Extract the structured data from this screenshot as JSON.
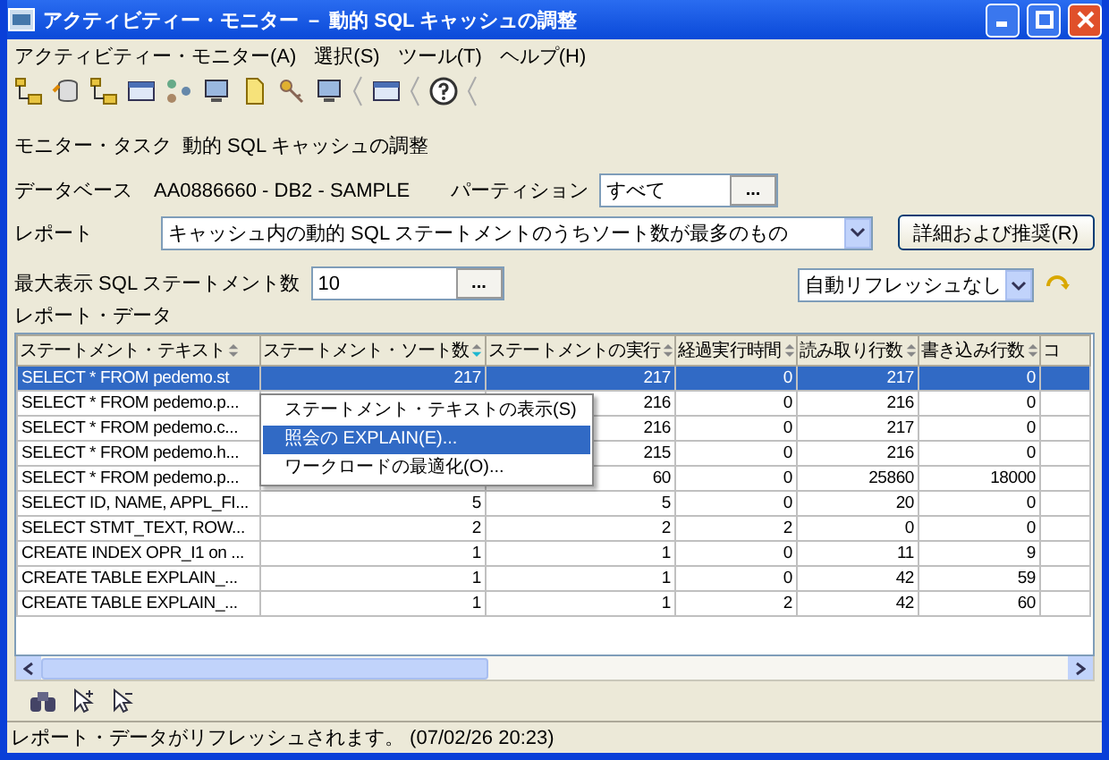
{
  "window": {
    "title": "アクティビティー・モニター － 動的 SQL キャッシュの調整"
  },
  "menu": [
    "アクティビティー・モニター(A)",
    "選択(S)",
    "ツール(T)",
    "ヘルプ(H)"
  ],
  "toolbar": [
    {
      "kind": "tree"
    },
    {
      "kind": "db"
    },
    {
      "kind": "tree"
    },
    {
      "kind": "window"
    },
    {
      "kind": "nodes"
    },
    {
      "kind": "monitor"
    },
    {
      "kind": "doc"
    },
    {
      "kind": "key"
    },
    {
      "kind": "monitor"
    },
    {
      "kind": "sep"
    },
    {
      "kind": "window"
    },
    {
      "kind": "sep"
    },
    {
      "kind": "help"
    },
    {
      "kind": "sep"
    }
  ],
  "task": {
    "label": "モニター・タスク",
    "value": "動的 SQL キャッシュの調整"
  },
  "database": {
    "label": "データベース",
    "value": "AA0886660 - DB2 - SAMPLE"
  },
  "partition": {
    "label": "パーティション",
    "value": "すべて",
    "button": "..."
  },
  "report": {
    "label": "レポート",
    "value": "キャッシュ内の動的 SQL ステートメントのうちソート数が最多のもの",
    "button": "詳細および推奨(R)"
  },
  "max_rows": {
    "label": "最大表示 SQL ステートメント数",
    "value": "10",
    "button": "..."
  },
  "auto_refresh": {
    "value": "自動リフレッシュなし"
  },
  "report_data": {
    "label": "レポート・データ"
  },
  "table": {
    "columns": [
      {
        "label": "ステートメント・テキスト",
        "sorted": false
      },
      {
        "label": "ステートメント・ソート数",
        "sorted": true
      },
      {
        "label": "ステートメントの実行",
        "sorted": false
      },
      {
        "label": "経過実行時間",
        "sorted": false
      },
      {
        "label": "読み取り行数",
        "sorted": false
      },
      {
        "label": "書き込み行数",
        "sorted": false
      },
      {
        "label": "コ"
      }
    ],
    "rows": [
      {
        "selected": true,
        "cells": [
          "SELECT * FROM pedemo.st",
          "217",
          "217",
          "0",
          "217",
          "0"
        ]
      },
      {
        "selected": false,
        "cells": [
          "SELECT * FROM pedemo.p...",
          null,
          "216",
          "0",
          "216",
          "0"
        ]
      },
      {
        "selected": false,
        "cells": [
          "SELECT * FROM pedemo.c...",
          null,
          "216",
          "0",
          "217",
          "0"
        ]
      },
      {
        "selected": false,
        "cells": [
          "SELECT * FROM pedemo.h...",
          null,
          "215",
          "0",
          "216",
          "0"
        ]
      },
      {
        "selected": false,
        "cells": [
          "SELECT * FROM pedemo.p...",
          null,
          "60",
          "0",
          "25860",
          "18000"
        ]
      },
      {
        "selected": false,
        "cells": [
          "SELECT ID, NAME, APPL_FI...",
          "5",
          "5",
          "0",
          "20",
          "0"
        ]
      },
      {
        "selected": false,
        "cells": [
          "SELECT STMT_TEXT, ROW...",
          "2",
          "2",
          "2",
          "0",
          "0"
        ]
      },
      {
        "selected": false,
        "cells": [
          "CREATE INDEX OPR_I1 on ...",
          "1",
          "1",
          "0",
          "11",
          "9"
        ]
      },
      {
        "selected": false,
        "cells": [
          "CREATE TABLE EXPLAIN_...",
          "1",
          "1",
          "0",
          "42",
          "59"
        ]
      },
      {
        "selected": false,
        "cells": [
          "CREATE TABLE EXPLAIN_...",
          "1",
          "1",
          "2",
          "42",
          "60"
        ]
      }
    ]
  },
  "context_menu": [
    {
      "label": "ステートメント・テキストの表示(S)",
      "selected": false
    },
    {
      "label": "照会の EXPLAIN(E)...",
      "selected": true
    },
    {
      "label": "ワークロードの最適化(O)...",
      "selected": false
    }
  ],
  "status_bar": "レポート・データがリフレッシュされます。 (07/02/26 20:23)"
}
